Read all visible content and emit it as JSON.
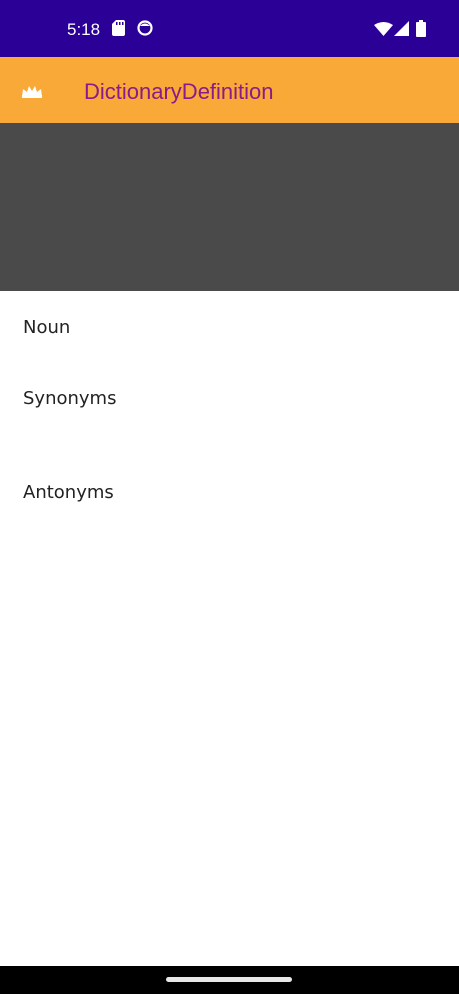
{
  "status_bar": {
    "time": "5:18",
    "icons": [
      "sd-card-icon",
      "face-icon",
      "wifi-icon",
      "signal-icon",
      "battery-icon"
    ]
  },
  "app_bar": {
    "title": "DictionaryDefinition",
    "logo_icon": "crown-icon",
    "background_color": "#f9a937",
    "title_color": "#8b1a8a"
  },
  "content": {
    "noun_label": "Noun",
    "synonyms_label": "Synonyms",
    "antonyms_label": "Antonyms"
  },
  "colors": {
    "status_bar": "#2a0096",
    "media_area": "#4a4a4a"
  }
}
